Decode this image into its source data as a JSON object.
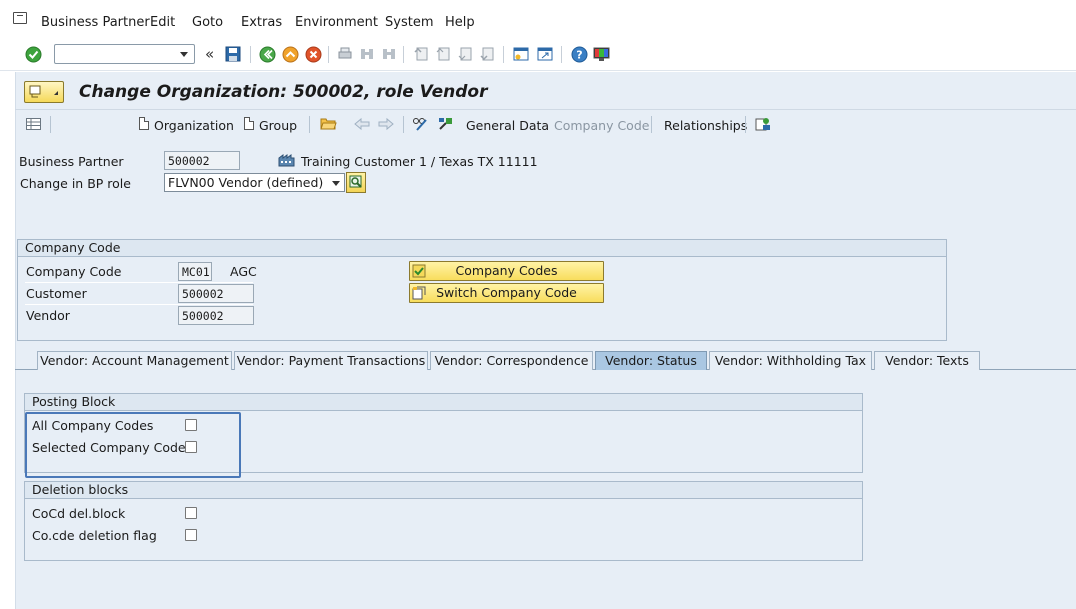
{
  "menubar": {
    "items": [
      "Business Partner",
      "Edit",
      "Goto",
      "Extras",
      "Environment",
      "System",
      "Help"
    ]
  },
  "toolbar": {
    "command_value": "",
    "icons": [
      "enter-icon",
      "command-field",
      "back-double-icon",
      "save-icon",
      "back-icon",
      "exit-icon",
      "cancel-icon",
      "print-icon",
      "find-icon",
      "find-next-icon",
      "first-page-icon",
      "prev-page-icon",
      "next-page-icon",
      "last-page-icon",
      "new-session-icon",
      "shortcut-icon",
      "help-icon",
      "layout-icon"
    ]
  },
  "title": {
    "text": "Change Organization: 500002, role Vendor"
  },
  "app_toolbar": {
    "organization": "Organization",
    "group": "Group",
    "general_data": "General Data",
    "company_code": "Company Code",
    "relationships": "Relationships"
  },
  "header": {
    "bp_label": "Business Partner",
    "bp_value": "500002",
    "bp_description": "Training Customer 1 / Texas TX 11111",
    "role_label": "Change in BP role",
    "role_value": "FLVN00 Vendor (defined)"
  },
  "company_code_group": {
    "title": "Company Code",
    "cc_label": "Company Code",
    "cc_value": "MC01",
    "cc_text": "AGC",
    "customer_label": "Customer",
    "customer_value": "500002",
    "vendor_label": "Vendor",
    "vendor_value": "500002",
    "btn_company_codes": "Company Codes",
    "btn_switch": "Switch Company Code"
  },
  "tabs": [
    {
      "label": "Vendor: Account Management",
      "active": false
    },
    {
      "label": "Vendor: Payment Transactions",
      "active": false
    },
    {
      "label": "Vendor: Correspondence",
      "active": false
    },
    {
      "label": "Vendor: Status",
      "active": true
    },
    {
      "label": "Vendor: Withholding Tax",
      "active": false
    },
    {
      "label": "Vendor: Texts",
      "active": false
    }
  ],
  "posting_block": {
    "title": "Posting Block",
    "all_cc_label": "All Company Codes",
    "all_cc_checked": false,
    "selected_cc_label": "Selected Company Code",
    "selected_cc_checked": false
  },
  "deletion_blocks": {
    "title": "Deletion blocks",
    "cocd_label": "CoCd del.block",
    "cocd_checked": false,
    "flag_label": "Co.cde deletion flag",
    "flag_checked": false
  },
  "colors": {
    "background": "#e7eef6",
    "active_tab": "#aac7e2",
    "button_yellow": "#f8dd5d",
    "highlight_border": "#4a78b8"
  }
}
